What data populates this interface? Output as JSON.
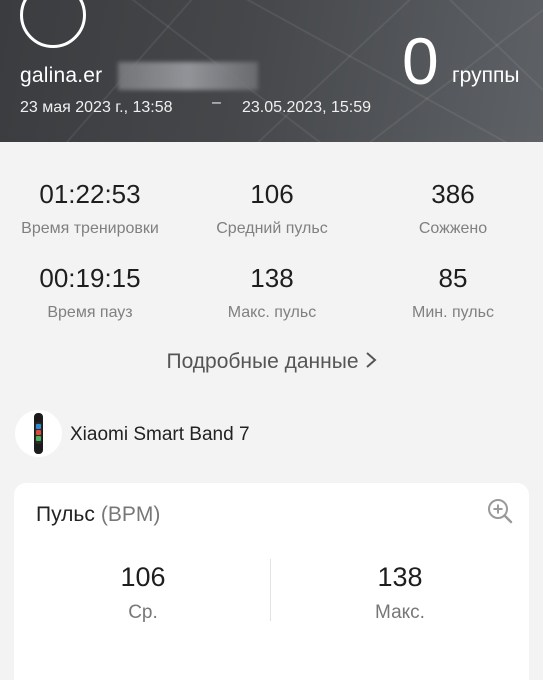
{
  "header": {
    "username": "galina.er",
    "date_start": "23 мая 2023 г., 13:58",
    "date_dash": "–",
    "date_end": "23.05.2023, 15:59",
    "group_count": "0",
    "group_label": "группы"
  },
  "stats": [
    {
      "value": "01:22:53",
      "label": "Время тренировки"
    },
    {
      "value": "106",
      "label": "Средний пульс"
    },
    {
      "value": "386",
      "label": "Сожжено"
    },
    {
      "value": "00:19:15",
      "label": "Время пауз"
    },
    {
      "value": "138",
      "label": "Макс. пульс"
    },
    {
      "value": "85",
      "label": "Мин. пульс"
    }
  ],
  "details_link": "Подробные данные",
  "device": {
    "name": "Xiaomi Smart Band 7",
    "icon": "smart-band-icon"
  },
  "pulse_card": {
    "title": "Пульс",
    "unit": "(BPM)",
    "zoom_icon": "zoom-in-icon",
    "avg_value": "106",
    "avg_label": "Ср.",
    "max_value": "138",
    "max_label": "Макс."
  },
  "colors": {
    "header_bg": "#45474a",
    "page_bg": "#f3f3f3",
    "card_bg": "#ffffff",
    "label_gray": "#808080"
  }
}
